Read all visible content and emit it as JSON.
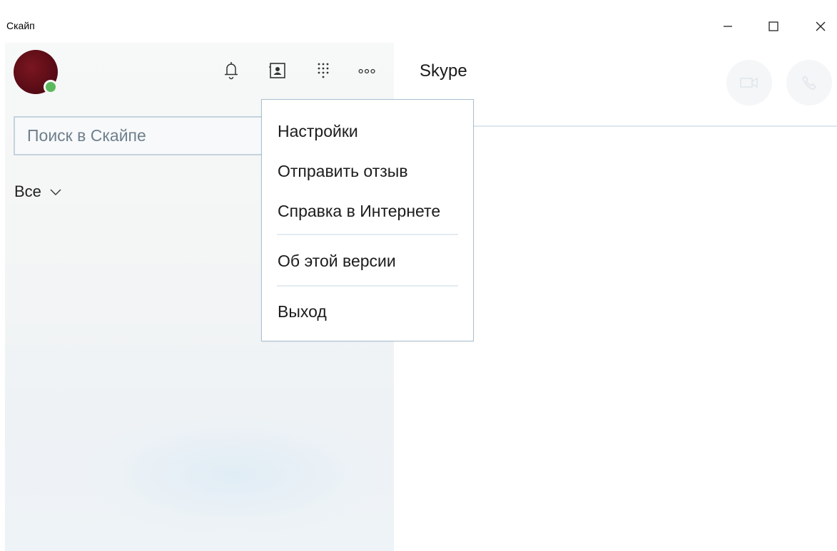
{
  "window": {
    "title": "Скайп",
    "minimize_icon": "minimize-icon",
    "maximize_icon": "maximize-icon",
    "close_icon": "close-icon"
  },
  "profile": {
    "avatar_color": "#6b1019",
    "presence_status": "online",
    "presence_color": "#5cb85c"
  },
  "toolbar": {
    "icons": [
      "bell-icon",
      "contacts-icon",
      "dialpad-icon",
      "more-icon"
    ]
  },
  "search": {
    "placeholder": "Поиск в Скайпе",
    "value": ""
  },
  "filter": {
    "label": "Все"
  },
  "main": {
    "title": "Skype",
    "video_call_icon": "video-icon",
    "audio_call_icon": "phone-icon"
  },
  "menu": {
    "settings": "Настройки",
    "feedback": "Отправить отзыв",
    "help": "Справка в Интернете",
    "about": "Об этой версии",
    "signout": "Выход"
  },
  "colors": {
    "accent_border": "#a9bfd0",
    "divider": "#dde7ef"
  }
}
